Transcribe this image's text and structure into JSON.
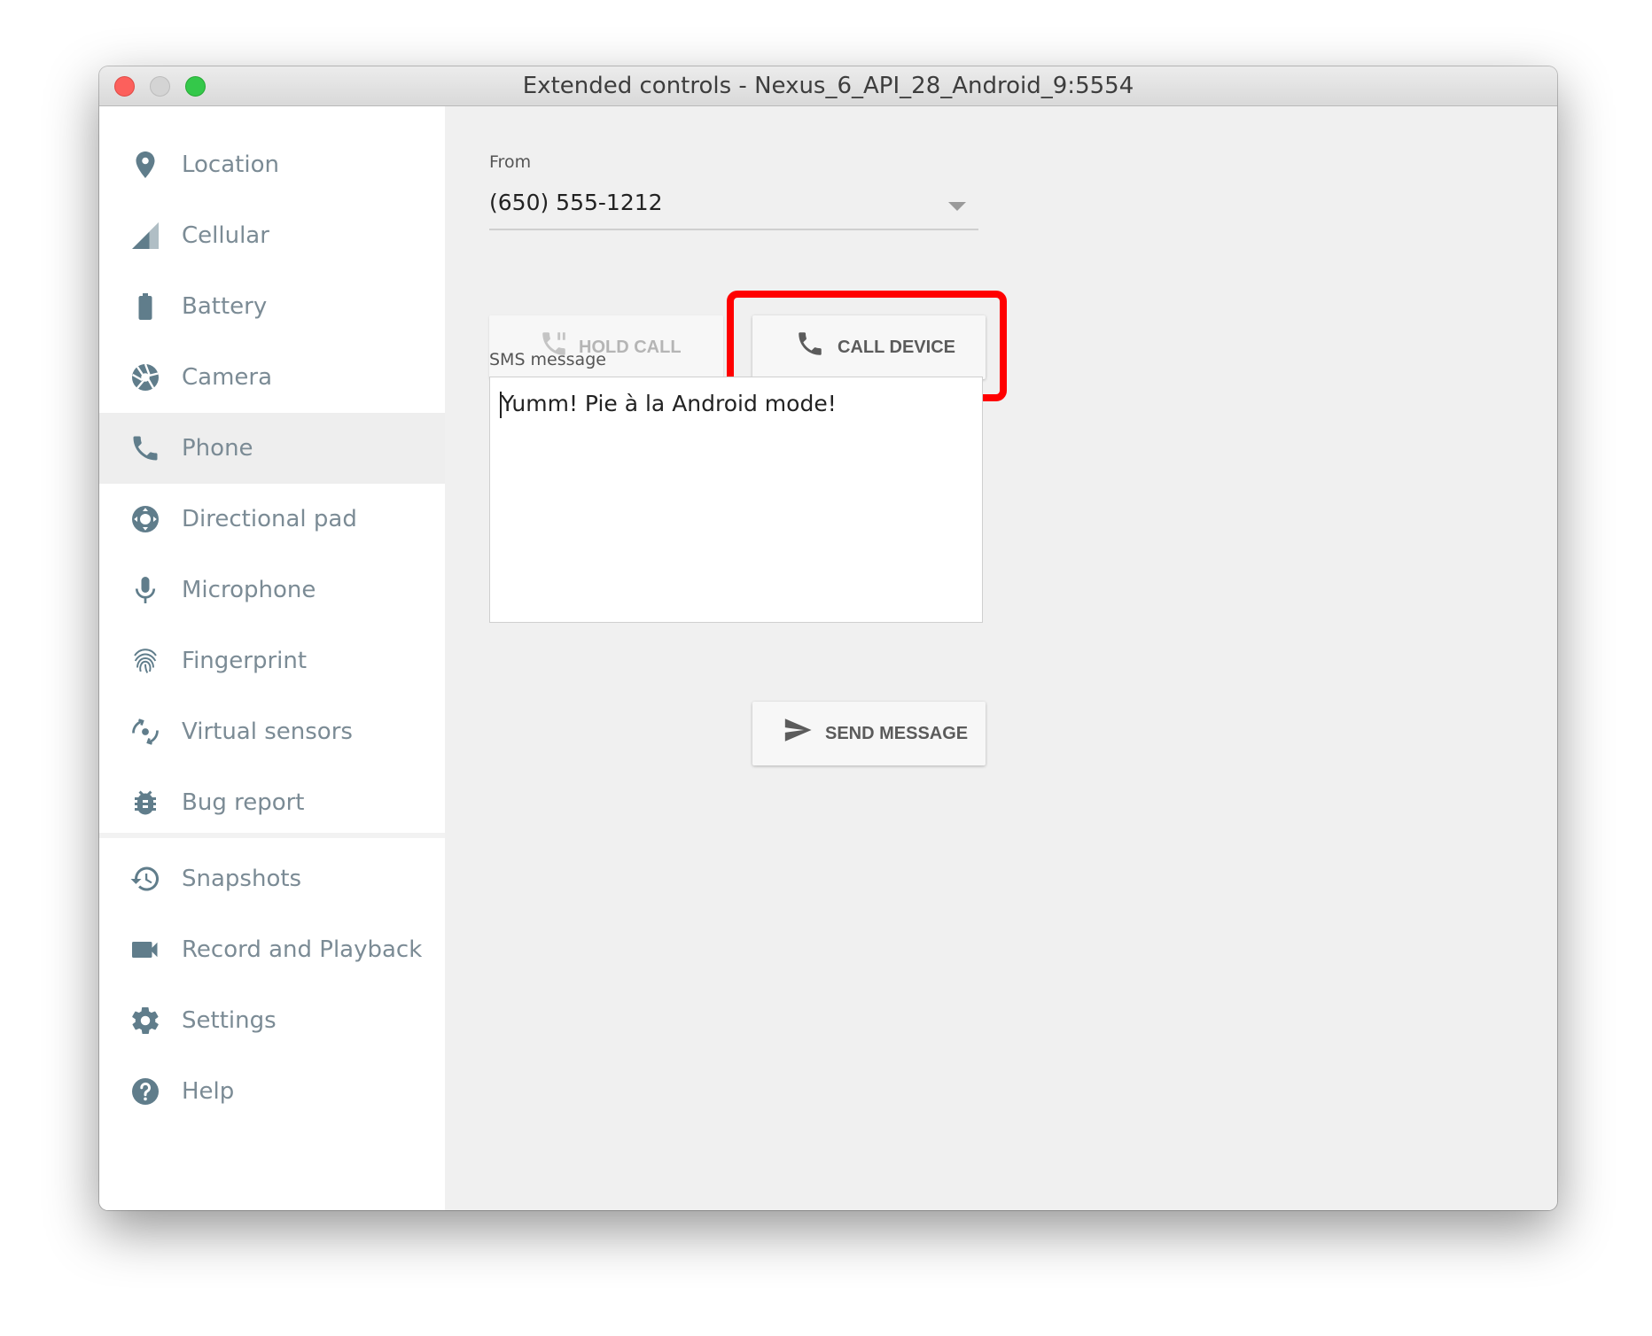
{
  "window": {
    "title": "Extended controls - Nexus_6_API_28_Android_9:5554"
  },
  "sidebar": {
    "items": [
      {
        "label": "Location",
        "icon": "location-pin-icon"
      },
      {
        "label": "Cellular",
        "icon": "cellular-signal-icon"
      },
      {
        "label": "Battery",
        "icon": "battery-icon"
      },
      {
        "label": "Camera",
        "icon": "camera-aperture-icon"
      },
      {
        "label": "Phone",
        "icon": "phone-icon",
        "selected": true
      },
      {
        "label": "Directional pad",
        "icon": "dpad-icon"
      },
      {
        "label": "Microphone",
        "icon": "microphone-icon"
      },
      {
        "label": "Fingerprint",
        "icon": "fingerprint-icon"
      },
      {
        "label": "Virtual sensors",
        "icon": "rotation-icon"
      },
      {
        "label": "Bug report",
        "icon": "bug-icon"
      },
      {
        "label": "Snapshots",
        "icon": "history-icon"
      },
      {
        "label": "Record and Playback",
        "icon": "videocam-icon"
      },
      {
        "label": "Settings",
        "icon": "gear-icon"
      },
      {
        "label": "Help",
        "icon": "help-icon"
      }
    ]
  },
  "phone": {
    "from_label": "From",
    "from_value": "(650) 555-1212",
    "hold_call_label": "HOLD CALL",
    "call_device_label": "CALL DEVICE",
    "sms_label": "SMS message",
    "sms_text": "Yumm! Pie à la Android mode!",
    "send_message_label": "SEND MESSAGE"
  },
  "colors": {
    "sidebar_text": "#7b8b95",
    "sidebar_icon": "#607d8b",
    "highlight_box": "#ff0000",
    "selected_row": "#eeeeee"
  }
}
